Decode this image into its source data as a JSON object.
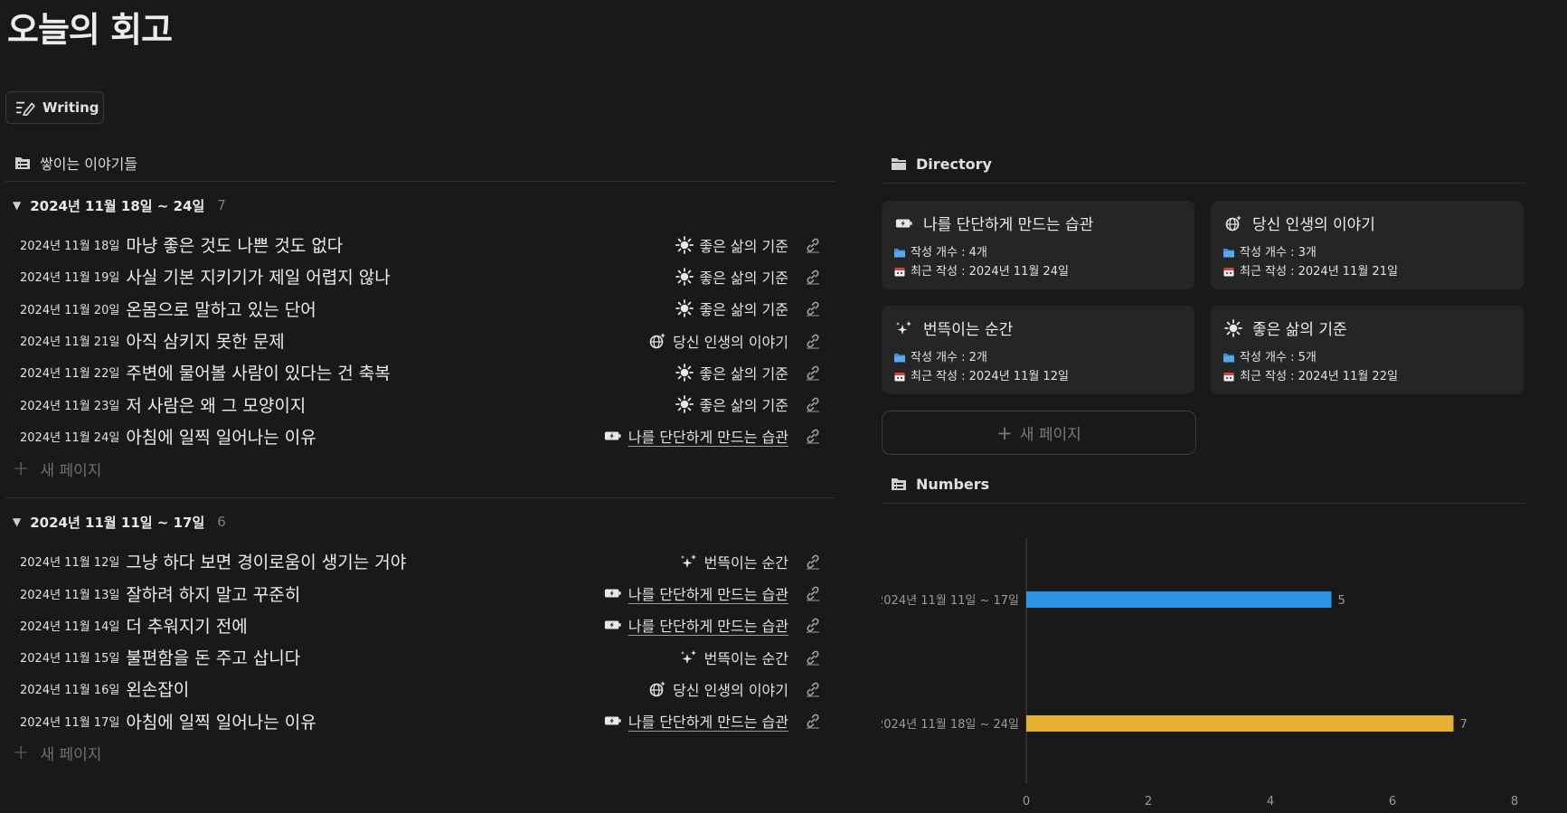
{
  "page": {
    "title": "오늘의 회고"
  },
  "writing_button": {
    "label": "Writing"
  },
  "stories": {
    "heading": "쌓이는 이야기들",
    "new_page_label": "새 페이지",
    "groups": [
      {
        "label": "2024년 11월 18일 ~ 24일",
        "count": "7",
        "rows": [
          {
            "date": "2024년 11월 18일",
            "title": "마냥 좋은 것도 나쁜 것도 없다",
            "category": "좋은 삶의 기준",
            "icon": "sun-icon"
          },
          {
            "date": "2024년 11월 19일",
            "title": "사실 기본 지키기가 제일 어렵지 않나",
            "category": "좋은 삶의 기준",
            "icon": "sun-icon"
          },
          {
            "date": "2024년 11월 20일",
            "title": "온몸으로 말하고 있는 단어",
            "category": "좋은 삶의 기준",
            "icon": "sun-icon"
          },
          {
            "date": "2024년 11월 21일",
            "title": "아직 삼키지 못한 문제",
            "category": "당신 인생의 이야기",
            "icon": "globe-sparkle-icon"
          },
          {
            "date": "2024년 11월 22일",
            "title": "주변에 물어볼 사람이 있다는 건 축복",
            "category": "좋은 삶의 기준",
            "icon": "sun-icon"
          },
          {
            "date": "2024년 11월 23일",
            "title": "저 사람은 왜 그 모양이지",
            "category": "좋은 삶의 기준",
            "icon": "sun-icon"
          },
          {
            "date": "2024년 11월 24일",
            "title": "아침에 일찍 일어나는 이유",
            "category": "나를 단단하게 만드는 습관",
            "icon": "battery-charging-icon"
          }
        ]
      },
      {
        "label": "2024년 11월 11일 ~ 17일",
        "count": "6",
        "rows": [
          {
            "date": "2024년 11월 12일",
            "title": "그냥 하다 보면 경이로움이 생기는 거야",
            "category": "번뜩이는 순간",
            "icon": "sparkles-icon"
          },
          {
            "date": "2024년 11월 13일",
            "title": "잘하려 하지 말고 꾸준히",
            "category": "나를 단단하게 만드는 습관",
            "icon": "battery-charging-icon"
          },
          {
            "date": "2024년 11월 14일",
            "title": "더 추워지기 전에",
            "category": "나를 단단하게 만드는 습관",
            "icon": "battery-charging-icon"
          },
          {
            "date": "2024년 11월 15일",
            "title": "불편함을 돈 주고 삽니다",
            "category": "번뜩이는 순간",
            "icon": "sparkles-icon"
          },
          {
            "date": "2024년 11월 16일",
            "title": "왼손잡이",
            "category": "당신 인생의 이야기",
            "icon": "globe-sparkle-icon"
          },
          {
            "date": "2024년 11월 17일",
            "title": "아침에 일찍 일어나는 이유",
            "category": "나를 단단하게 만드는 습관",
            "icon": "battery-charging-icon"
          }
        ]
      }
    ]
  },
  "directory": {
    "heading": "Directory",
    "new_page_label": "새 페이지",
    "cards": [
      {
        "title": "나를 단단하게 만드는 습관",
        "icon": "battery-charging-icon",
        "count_text": "작성 개수 : 4개",
        "recent_text": "최근 작성 : 2024년 11월 24일"
      },
      {
        "title": "당신 인생의 이야기",
        "icon": "globe-sparkle-icon",
        "count_text": "작성 개수 : 3개",
        "recent_text": "최근 작성 : 2024년 11월 21일"
      },
      {
        "title": "번뜩이는 순간",
        "icon": "sparkles-icon",
        "count_text": "작성 개수 : 2개",
        "recent_text": "최근 작성 : 2024년 11월 12일"
      },
      {
        "title": "좋은 삶의 기준",
        "icon": "sun-icon",
        "count_text": "작성 개수 : 5개",
        "recent_text": "최근 작성 : 2024년 11월 22일"
      }
    ]
  },
  "numbers": {
    "heading": "Numbers"
  },
  "chart_data": {
    "type": "bar",
    "orientation": "horizontal",
    "categories": [
      "2024년 11월 11일 ~ 17일",
      "2024년 11월 18일 ~ 24일"
    ],
    "values": [
      5,
      7
    ],
    "colors": [
      "#2b93e6",
      "#e6b12e"
    ],
    "xlim": [
      0,
      8
    ],
    "xticks": [
      "0",
      "2",
      "4",
      "6",
      "8"
    ],
    "data_labels": [
      "5",
      "7"
    ],
    "grid": false
  }
}
